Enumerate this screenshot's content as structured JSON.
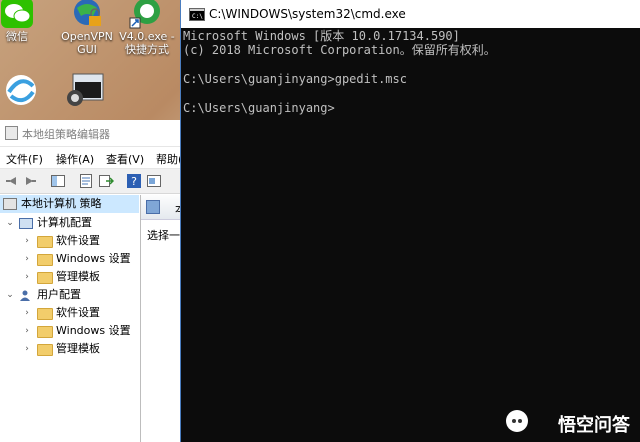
{
  "desktop": {
    "icons": [
      {
        "label": "微信",
        "icon": "wechat-icon"
      },
      {
        "label": "OpenVPN\nGUI",
        "icon": "openvpn-icon"
      },
      {
        "label": "V4.0.exe -\n快捷方式",
        "icon": "shortcut-icon"
      },
      {
        "label": "",
        "icon": "ev-icon"
      },
      {
        "label": "",
        "icon": "remote-desktop-icon"
      }
    ]
  },
  "gpedit": {
    "title": "本地组策略编辑器",
    "menu": [
      "文件(F)",
      "操作(A)",
      "查看(V)",
      "帮助("
    ],
    "tree": {
      "root": "本地计算机 策略",
      "computer": "计算机配置",
      "computer_children": [
        "软件设置",
        "Windows 设置",
        "管理模板"
      ],
      "user": "用户配置",
      "user_children": [
        "软件设置",
        "Windows 设置",
        "管理模板"
      ]
    },
    "right_header": "本",
    "right_text": "选择一"
  },
  "cmd": {
    "title": "C:\\WINDOWS\\system32\\cmd.exe",
    "lines": [
      "Microsoft Windows [版本 10.0.17134.590]",
      "(c) 2018 Microsoft Corporation。保留所有权利。",
      "",
      "C:\\Users\\guanjinyang>gpedit.msc",
      "",
      "C:\\Users\\guanjinyang>"
    ]
  },
  "watermark": {
    "text": "悟空问答"
  },
  "colors": {
    "cmd_bg": "#0c0c0c",
    "cmd_text": "#c0c0c0",
    "selected_row": "#cce8ff",
    "folder": "#f2cd6b"
  }
}
